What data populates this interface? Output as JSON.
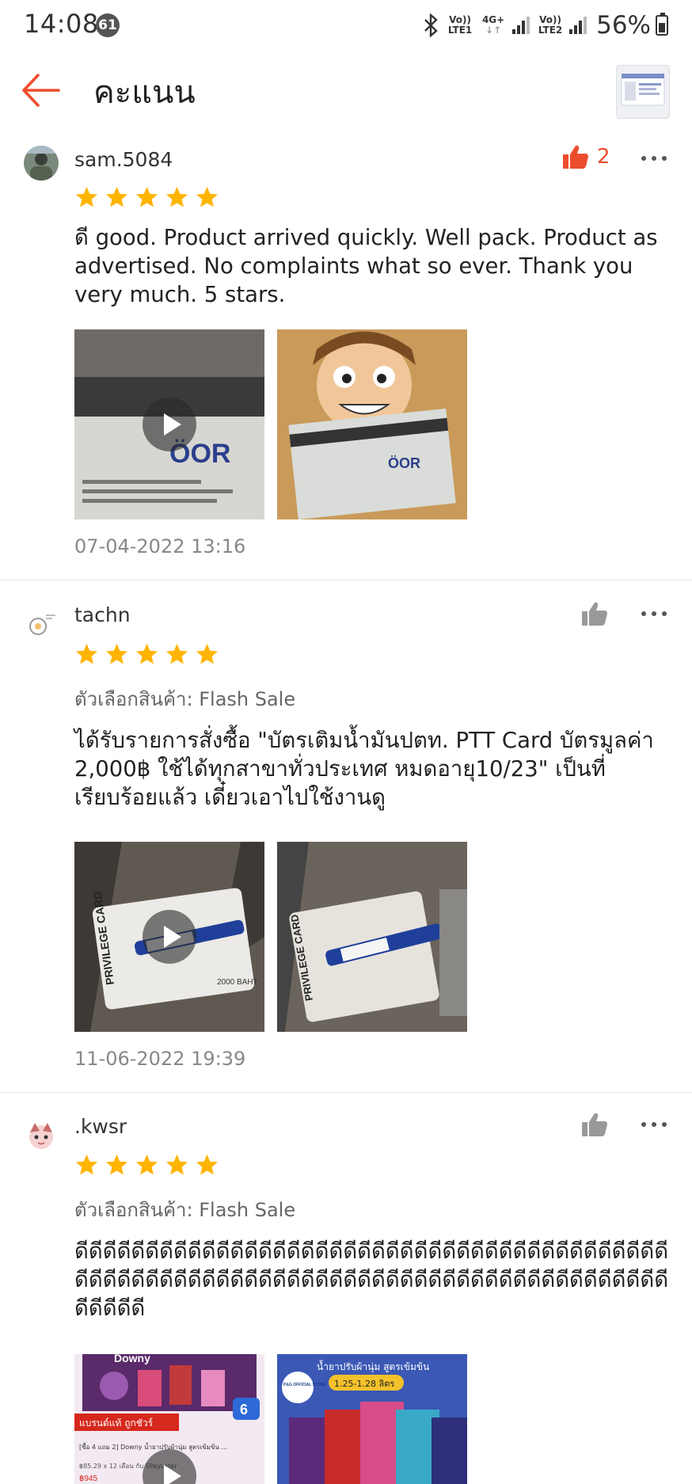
{
  "status_bar": {
    "time": "14:08",
    "notification_count": "61",
    "sim1_label_top": "Vo))",
    "sim1_label_bottom": "LTE1",
    "network_type": "4G+",
    "sim2_label_top": "Vo))",
    "sim2_label_bottom": "LTE2",
    "battery": "56%"
  },
  "header": {
    "title": "คะแนน",
    "back_icon": "arrow-left-icon"
  },
  "colors": {
    "accent": "#ee4d2d",
    "star": "#ffb400",
    "muted_text": "#888888"
  },
  "reviews": [
    {
      "username": "sam.5084",
      "likes": "2",
      "liked": true,
      "rating": 5,
      "variant": null,
      "text": "ดี good. Product arrived quickly. Well pack.  Product as advertised. No complaints what so ever. Thank you very much. 5  stars.",
      "date": "07-04-2022 13:16",
      "media_count": 2
    },
    {
      "username": "tachn",
      "likes": "",
      "liked": false,
      "rating": 5,
      "variant": "ตัวเลือกสินค้า: Flash Sale",
      "text": "ได้รับรายการสั่งซื้อ \"บัตรเติมน้ำมันปตท. PTT Card บัตรมูลค่า 2,000฿ ใช้ได้ทุกสาขาทั่วประเทศ หมดอายุ10/23\" เป็นที่เรียบร้อยแล้ว เดี๋ยวเอาไปใช้งานดู",
      "date": "11-06-2022 19:39",
      "media_count": 2
    },
    {
      "username": ".kwsr",
      "likes": "",
      "liked": false,
      "rating": 5,
      "variant": "ตัวเลือกสินค้า: Flash Sale",
      "text": "ดีดีดีดีดีดีดีดีดีดีดีดีดีดีดีดีดีดีดีดีดีดีดีดีดีดีดีดีดีดีดีดีดีดีดีดีดีดีดีดีดีดีดีดีดีดีดีดีดีดีดีดีดีดีดีดีดีดีดีดีดีดีดีดีดีดีดีดีดีดีดีดีดีดีดีดีดีดีดีดีดีดีดีดีดีดีดีดีดี",
      "media_count": 2,
      "media_text": {
        "brand": "Downy",
        "badge": "แบรนด์แท้ ถูกชัวร์",
        "pack": "6",
        "deal": "[ซื้อ 4 แถม 2] Downy น้ำยาปรับผ้านุ่ม สูตรเข้มข้น ...",
        "price_line": "฿85.29 x 12 เดือน กับ SPayLater",
        "price": "฿945",
        "banner": "น้ำยาปรับผ้านุ่ม สูตรเข้มข้น",
        "size": "1.25-1.28 ลิตร",
        "store": "P&G OFFICIAL STORE"
      }
    }
  ]
}
